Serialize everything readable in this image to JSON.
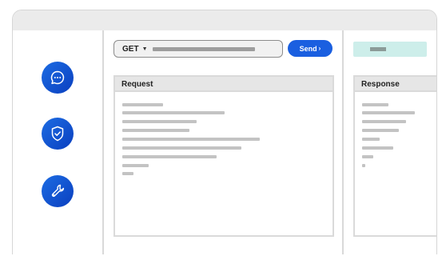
{
  "app": {
    "sidebar": {
      "buttons": [
        {
          "id": "chat",
          "icon": "chat-bubble-icon"
        },
        {
          "id": "security",
          "icon": "shield-check-icon"
        },
        {
          "id": "tools",
          "icon": "wrench-icon"
        }
      ]
    },
    "request_bar": {
      "method": "GET",
      "method_dropdown_icon": "caret-down-icon",
      "send_label": "Send",
      "send_icon": "chevron-right-icon"
    },
    "request_panel": {
      "title": "Request"
    },
    "response_panel": {
      "title": "Response"
    },
    "colors": {
      "accent": "#1a5fe0",
      "icon_button": "#0b4ad0",
      "status_badge": "#cdeeea",
      "panel_header": "#e6e6e6",
      "placeholder_line": "#c3c3c3"
    }
  }
}
